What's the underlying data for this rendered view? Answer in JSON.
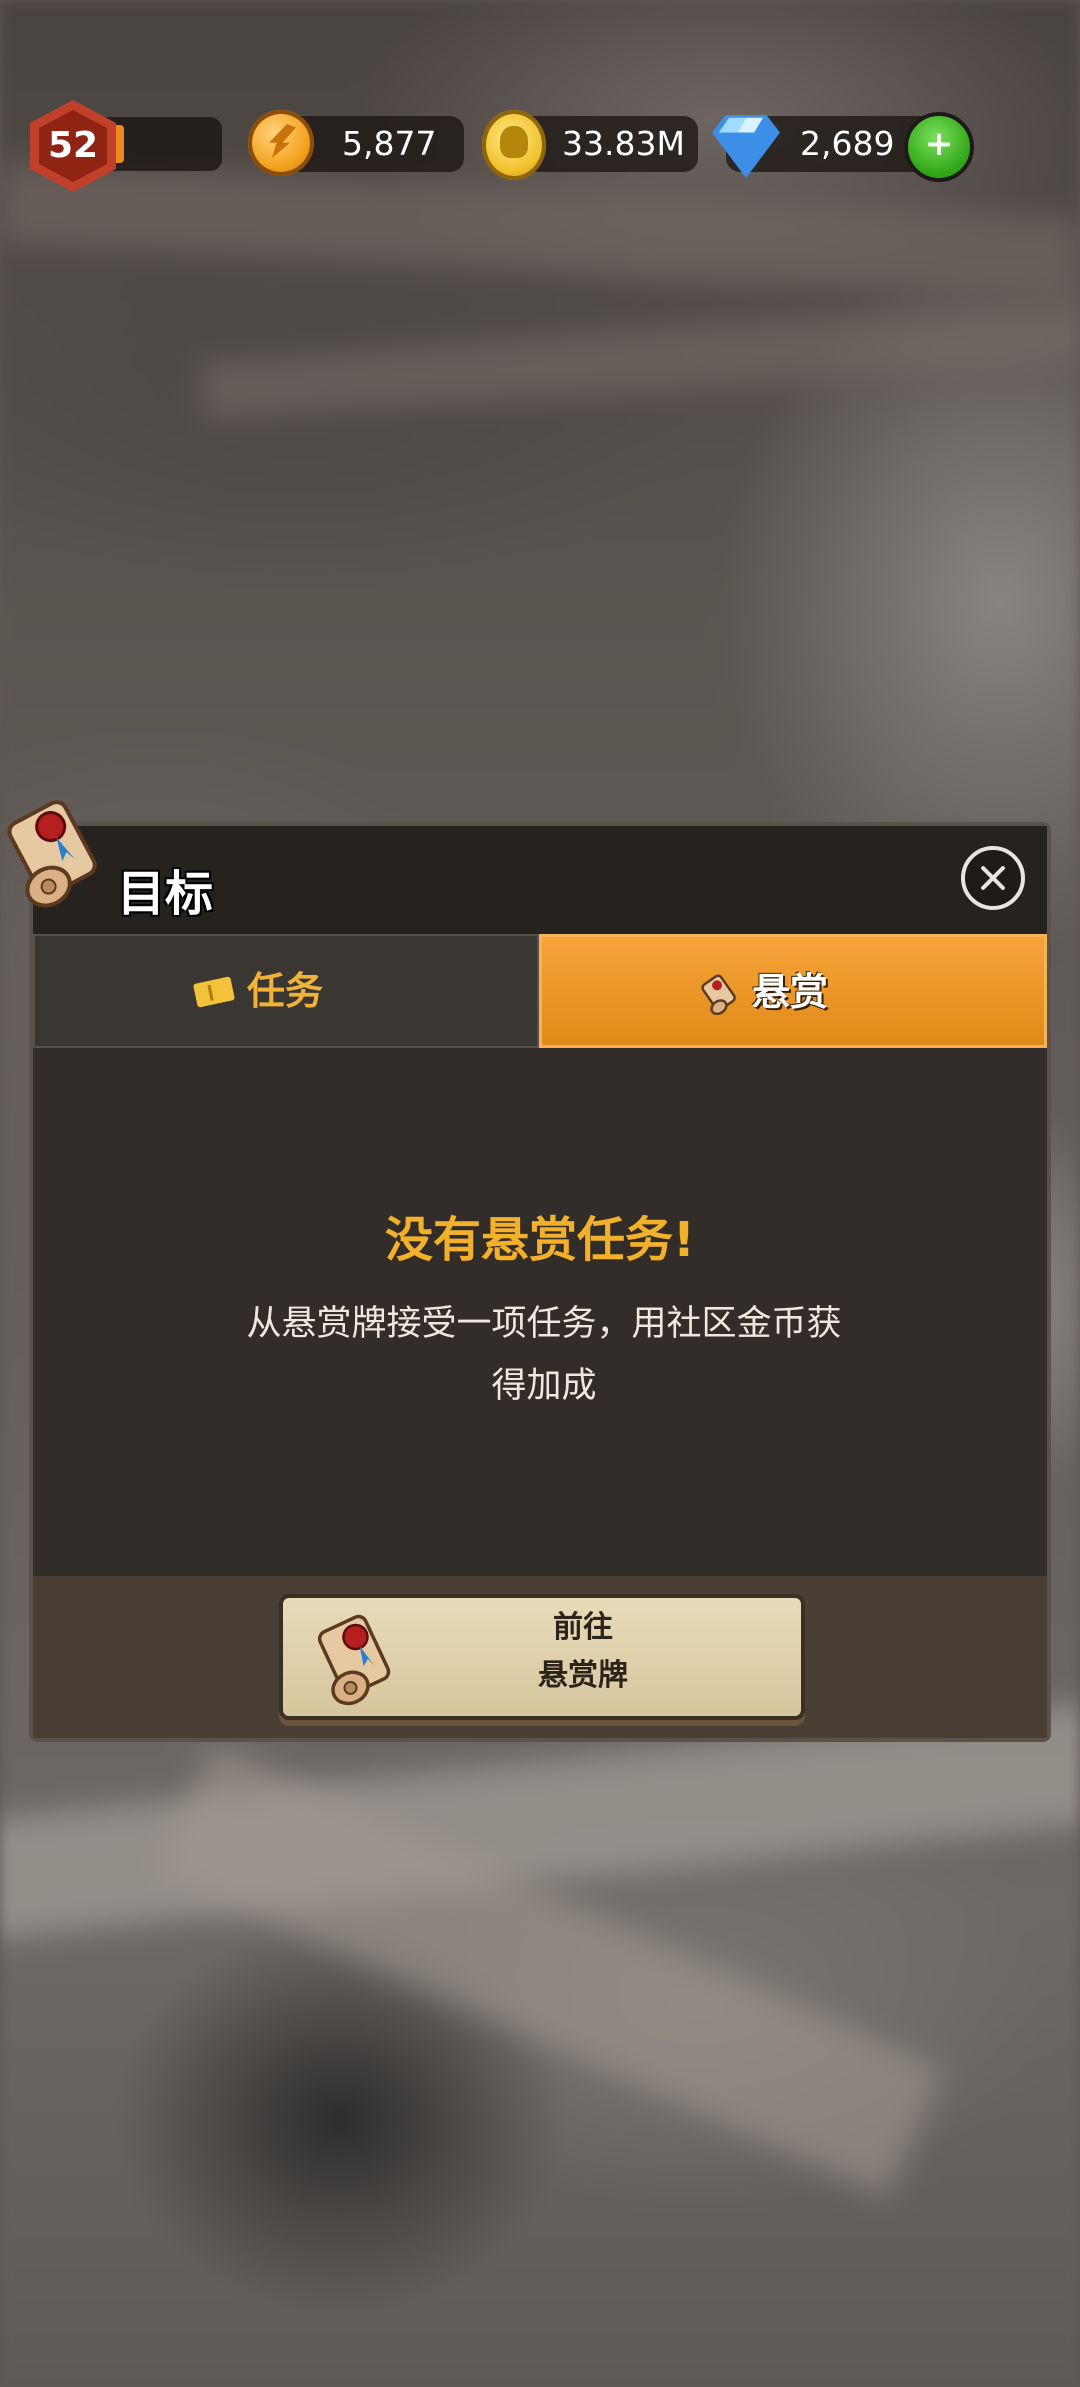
{
  "hud": {
    "level": "52",
    "level_progress": 0.2,
    "currency_orange": "5,877",
    "currency_gold": "33.83M",
    "gems": "2,689",
    "add_label": "+"
  },
  "dialog": {
    "title": "目标",
    "tabs": [
      {
        "label": "任务",
        "active": false
      },
      {
        "label": "悬赏",
        "active": true
      }
    ],
    "empty_title": "没有悬赏任务!",
    "empty_desc": "从悬赏牌接受一项任务，用社区金币获得加成",
    "goto_button": {
      "line1": "前往",
      "line2": "悬赏牌"
    }
  },
  "colors": {
    "accent": "#f3b12b",
    "active_tab": "#e08a17",
    "panel": "#332d29"
  }
}
